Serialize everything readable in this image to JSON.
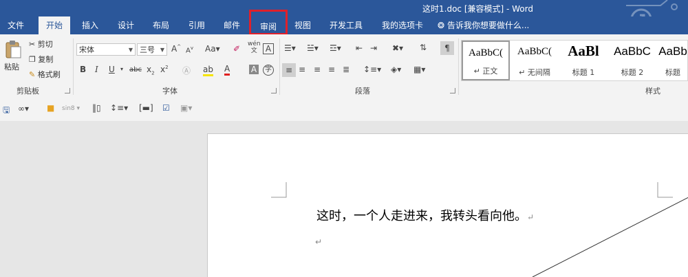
{
  "window": {
    "title": "这时1.doc [兼容模式] - Word"
  },
  "tabs": [
    {
      "label": "文件"
    },
    {
      "label": "开始"
    },
    {
      "label": "插入"
    },
    {
      "label": "设计"
    },
    {
      "label": "布局"
    },
    {
      "label": "引用"
    },
    {
      "label": "邮件"
    },
    {
      "label": "审阅"
    },
    {
      "label": "视图"
    },
    {
      "label": "开发工具"
    },
    {
      "label": "我的选项卡"
    }
  ],
  "tell_me": "告诉我你想要做什么...",
  "clipboard": {
    "paste": "粘贴",
    "cut": "剪切",
    "copy": "复制",
    "format_painter": "格式刷",
    "group": "剪贴板"
  },
  "font": {
    "name": "宋体",
    "size": "三号",
    "group": "字体",
    "wen_top": "wén",
    "wen_bottom": "文"
  },
  "paragraph": {
    "group": "段落"
  },
  "styles": {
    "group": "样式",
    "items": [
      {
        "sample": "AaBbC(",
        "name": "↵ 正文"
      },
      {
        "sample": "AaBbC(",
        "name": "↵ 无间隔"
      },
      {
        "sample": "AaBl",
        "name": "标题 1"
      },
      {
        "sample": "AaBbC",
        "name": "标题 2"
      },
      {
        "sample": "AaBb",
        "name": "标题"
      }
    ]
  },
  "qat": {
    "font_name": "sin8"
  },
  "document": {
    "line1": "这时，一个人走进来，我转头看向他。",
    "mark": "↵",
    "mark2": "↵"
  }
}
